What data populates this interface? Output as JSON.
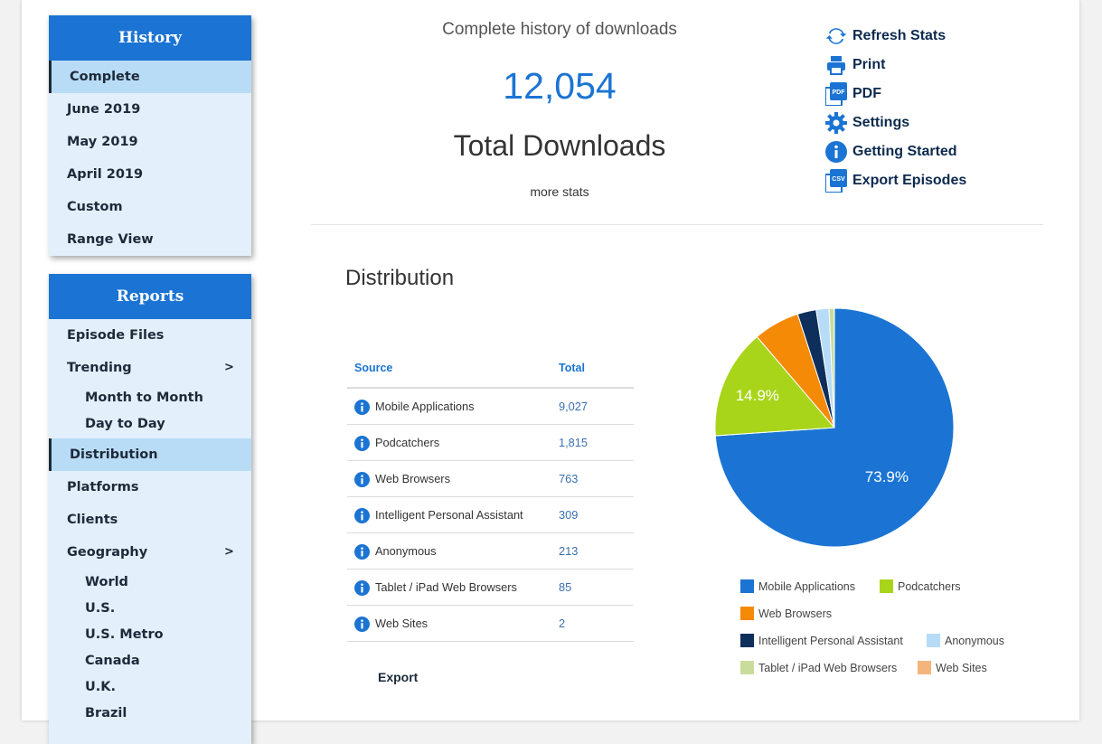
{
  "history": {
    "title": "History",
    "items": [
      {
        "label": "Complete",
        "active": true
      },
      {
        "label": "June 2019"
      },
      {
        "label": "May 2019"
      },
      {
        "label": "April 2019"
      },
      {
        "label": "Custom"
      },
      {
        "label": "Range View"
      }
    ]
  },
  "reports": {
    "title": "Reports",
    "episode_files": "Episode Files",
    "trending": "Trending",
    "month_to_month": "Month to Month",
    "day_to_day": "Day to Day",
    "distribution": "Distribution",
    "platforms": "Platforms",
    "clients": "Clients",
    "geography": "Geography",
    "world": "World",
    "us": "U.S.",
    "us_metro": "U.S. Metro",
    "canada": "Canada",
    "uk": "U.K.",
    "brazil": "Brazil",
    "chevron": ">"
  },
  "summary": {
    "title": "Complete history of downloads",
    "count": "12,054",
    "label": "Total Downloads",
    "more": "more stats"
  },
  "actions": {
    "refresh": "Refresh Stats",
    "print": "Print",
    "pdf": "PDF",
    "settings": "Settings",
    "getting_started": "Getting Started",
    "export_episodes": "Export Episodes",
    "pdf_icon_text": "PDF",
    "csv_icon_text": "CSV"
  },
  "distribution": {
    "title": "Distribution",
    "col_source": "Source",
    "col_total": "Total",
    "export": "Export",
    "rows": [
      {
        "source": "Mobile Applications",
        "total": "9,027"
      },
      {
        "source": "Podcatchers",
        "total": "1,815"
      },
      {
        "source": "Web Browsers",
        "total": "763"
      },
      {
        "source": "Intelligent Personal Assistant",
        "total": "309"
      },
      {
        "source": "Anonymous",
        "total": "213"
      },
      {
        "source": "Tablet / iPad Web Browsers",
        "total": "85"
      },
      {
        "source": "Web Sites",
        "total": "2"
      }
    ]
  },
  "chart_data": {
    "type": "pie",
    "categories": [
      "Mobile Applications",
      "Podcatchers",
      "Web Browsers",
      "Intelligent Personal Assistant",
      "Anonymous",
      "Tablet / iPad Web Browsers",
      "Web Sites"
    ],
    "values": [
      9027,
      1815,
      763,
      309,
      213,
      85,
      2
    ],
    "colors": [
      "#1b74d3",
      "#a8d51a",
      "#f58a07",
      "#0e2f5c",
      "#b6dcf7",
      "#c9dc9c",
      "#f3b57a"
    ],
    "slice_labels": [
      "73.9%",
      "14.9%",
      "",
      "",
      "",
      "",
      ""
    ]
  }
}
